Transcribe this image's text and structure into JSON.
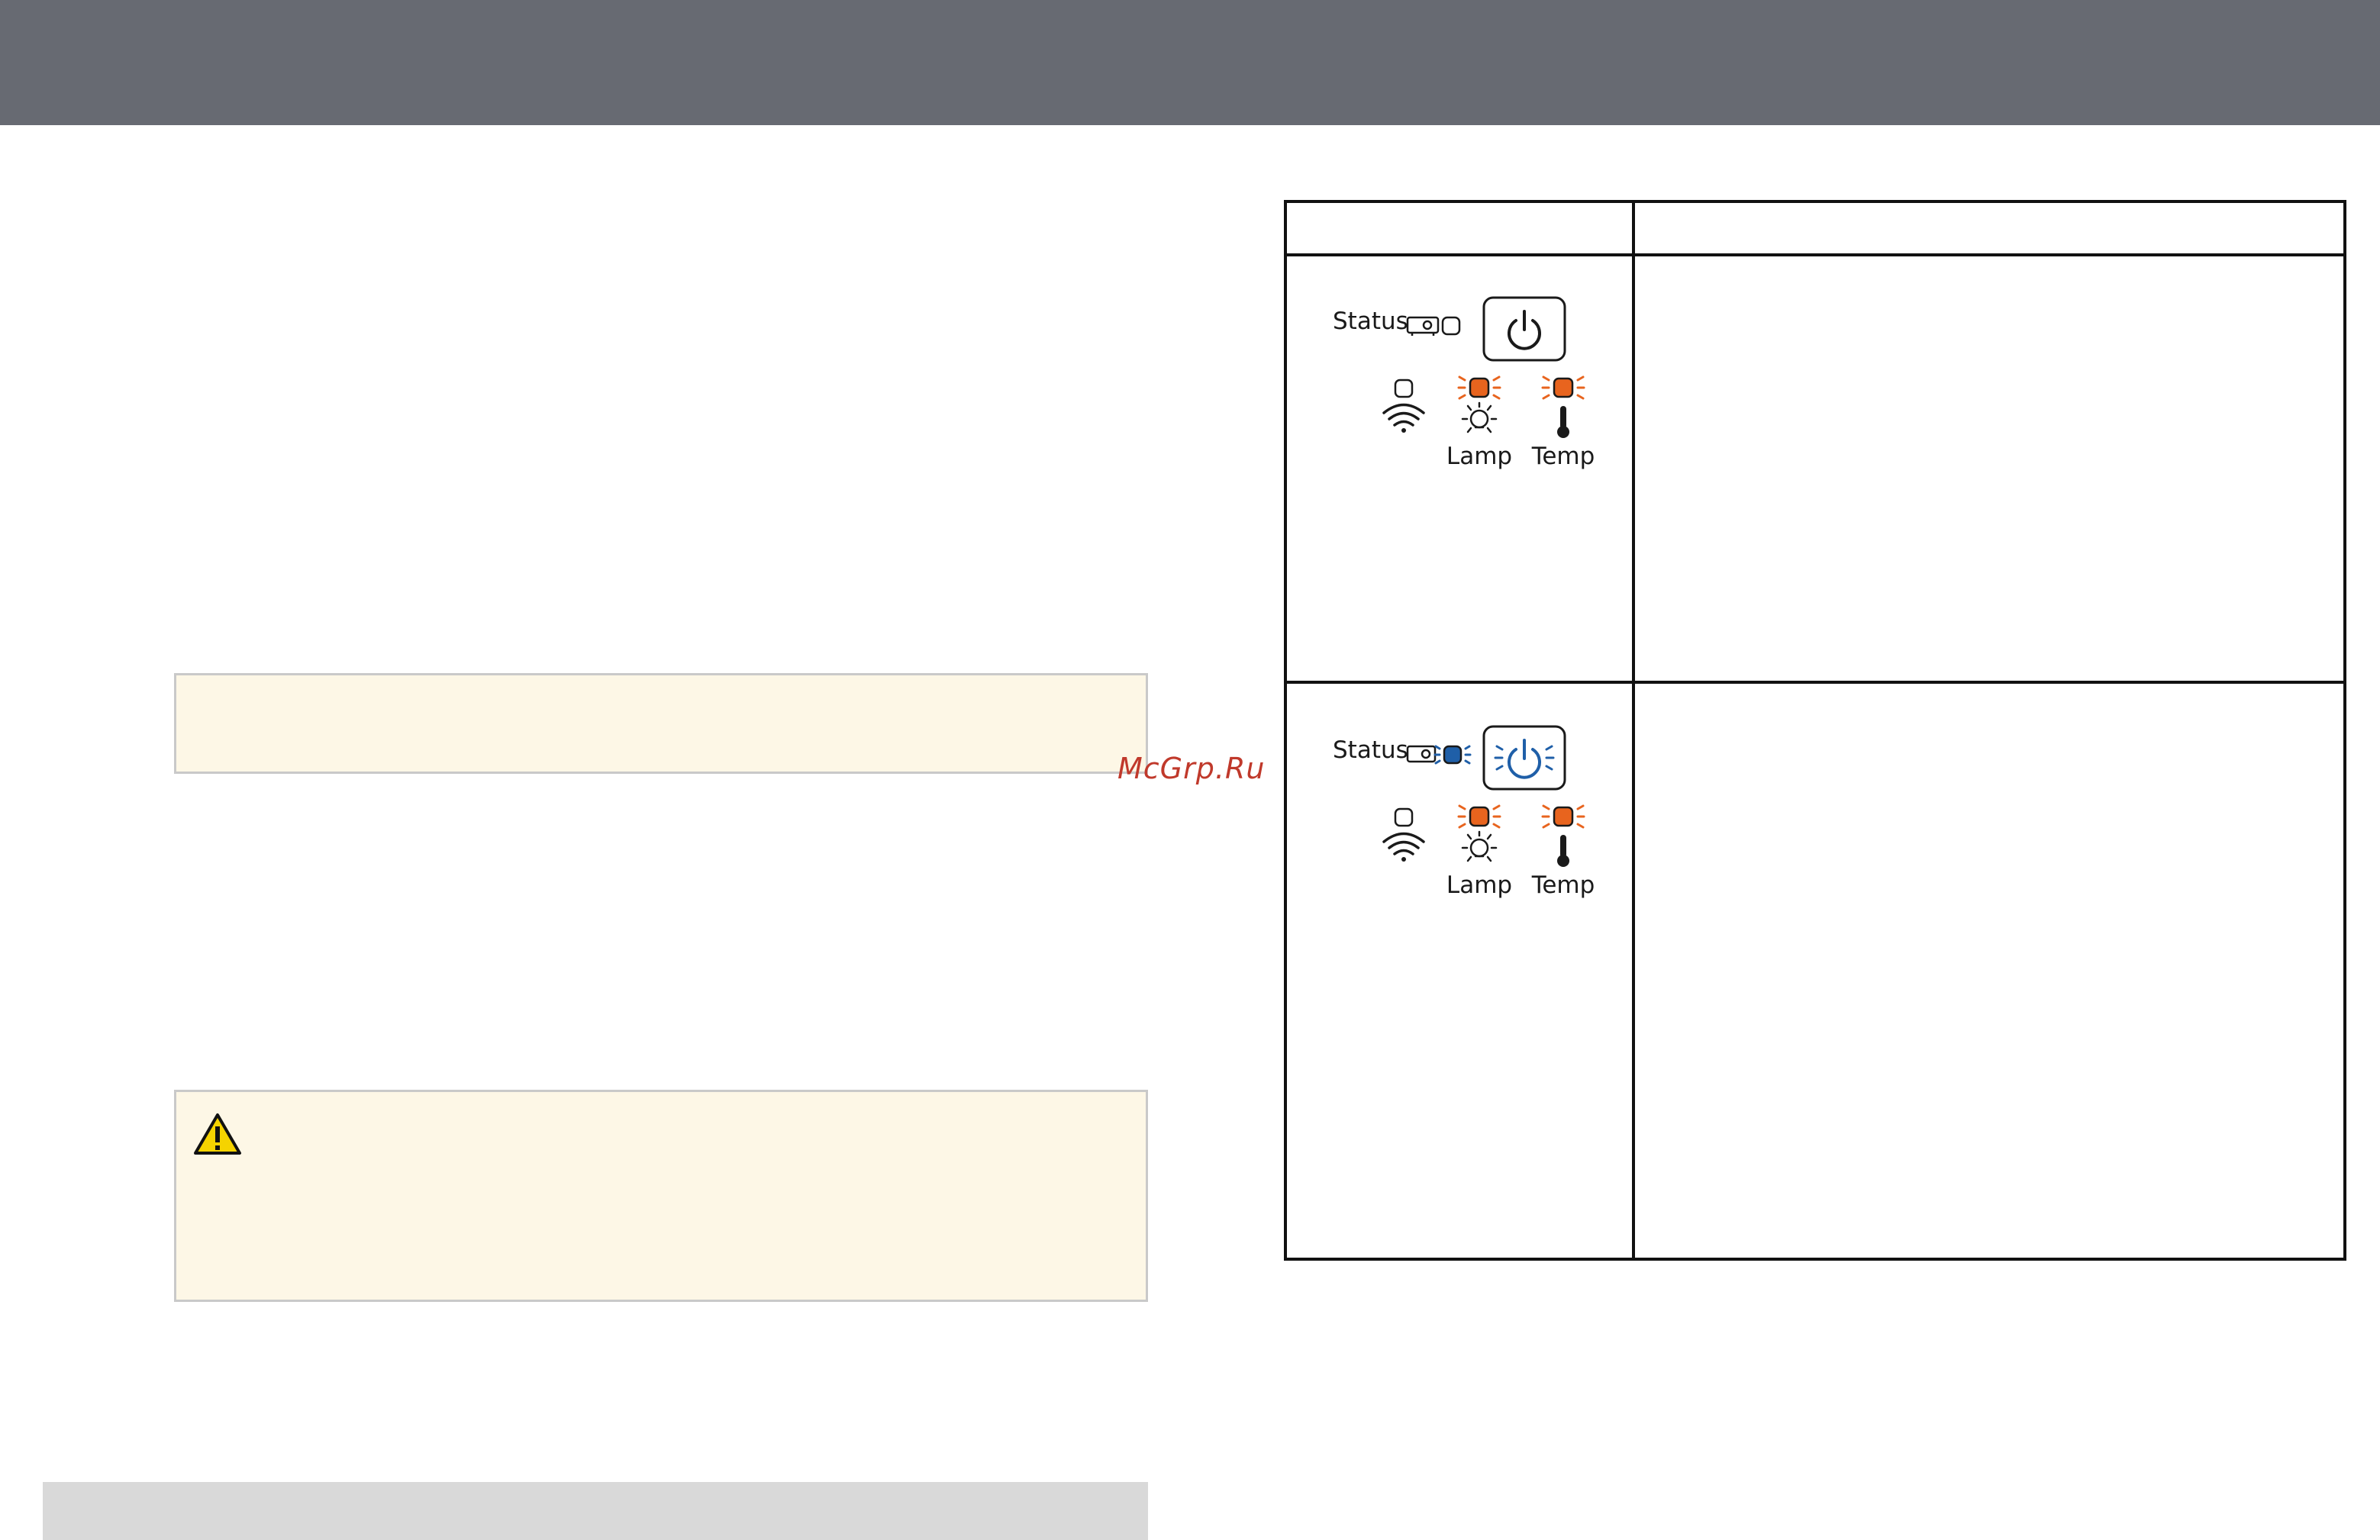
{
  "watermark": "McGrp.Ru",
  "indicator_table": {
    "rows": [
      {
        "status_label": "Status",
        "lamp_label": "Lamp",
        "temp_label": "Temp",
        "status_light": "off",
        "power_light": "off",
        "wifi_light": "off",
        "lamp_light": "flashing-orange",
        "temp_light": "flashing-orange"
      },
      {
        "status_label": "Status",
        "lamp_label": "Lamp",
        "temp_label": "Temp",
        "status_light": "flashing-blue",
        "power_light": "flashing-blue",
        "wifi_light": "off",
        "lamp_light": "flashing-orange",
        "temp_light": "flashing-orange"
      }
    ]
  },
  "colors": {
    "header_bar": "#676a72",
    "note_bg": "#fdf7e6",
    "orange_light": "#e8641e",
    "blue_light": "#1f5fa8",
    "warning_yellow": "#f5d300"
  }
}
